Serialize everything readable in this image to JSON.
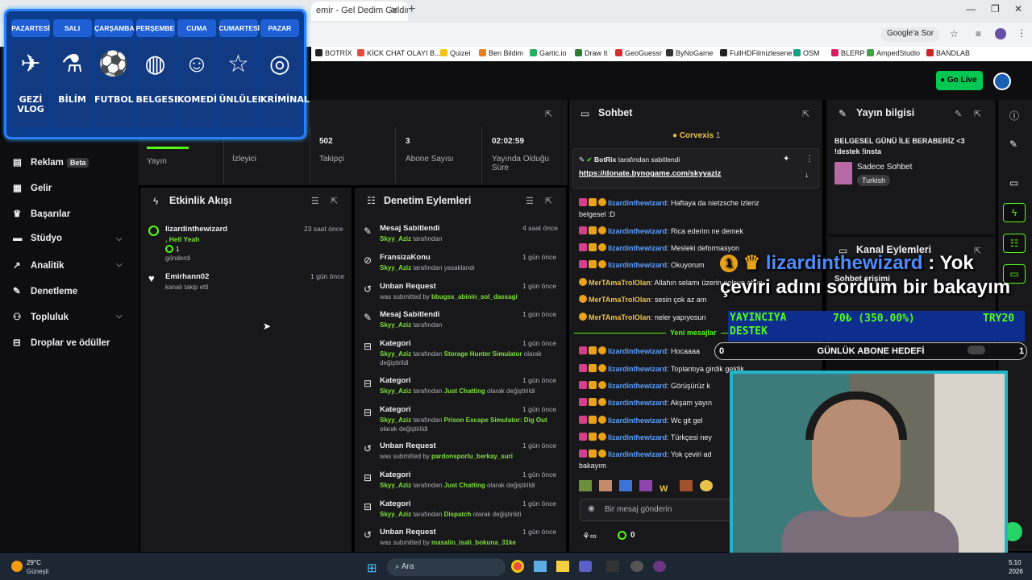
{
  "browser": {
    "tab_title": "emir - Gel Dedim Geldin",
    "google_sor": "Google'a Sor",
    "bookmarks": [
      "BOTRİX",
      "KİCK CHAT OLAYI B...",
      "Quizei",
      "Ben Bildim",
      "Gartic.io",
      "Draw It",
      "GeoGuessr",
      "ByNoGame",
      "FullHDFilmizlesene",
      "OSM",
      "BLERP",
      "AmpedStudio",
      "BANDLAB"
    ]
  },
  "header": {
    "go_live": "Go Live"
  },
  "schedule": {
    "days": [
      "PAZARTESİ",
      "SALI",
      "ÇARŞAMBA",
      "PERŞEMBE",
      "CUMA",
      "CUMARTESİ",
      "PAZAR"
    ],
    "categories": [
      {
        "label": "GEZİ VLOG",
        "icon": "globe-plane-icon"
      },
      {
        "label": "BİLİM",
        "icon": "science-icon"
      },
      {
        "label": "FUTBOL",
        "icon": "soccer-ball-icon"
      },
      {
        "label": "BELGESEL",
        "icon": "earth-icon"
      },
      {
        "label": "KOMEDİ",
        "icon": "comedy-masks-icon"
      },
      {
        "label": "ÜNLÜLER",
        "icon": "star-icon"
      },
      {
        "label": "KRİMİNAL",
        "icon": "fingerprint-icon"
      }
    ]
  },
  "nav": {
    "reklam": "Reklam",
    "beta": "Beta",
    "gelir": "Gelir",
    "basarilar": "Başarılar",
    "studyo": "Stüdyo",
    "analitik": "Analitik",
    "denetleme": "Denetleme",
    "topluluk": "Topluluk",
    "droplar": "Droplar ve ödüller"
  },
  "stats": {
    "yayin": "Yayın",
    "izleyici": "İzleyici",
    "takipci_value": "502",
    "takipci": "Takipçi",
    "abone_value": "3",
    "abone": "Abone Sayısı",
    "sure_value": "02:02:59",
    "sure": "Yayında Olduğu Süre"
  },
  "activity": {
    "title": "Etkinlik Akışı",
    "items": [
      {
        "name": "lizardinthewizard",
        "line1": ", Hell Yeah",
        "line2": "1",
        "line3": "gönderdi",
        "time": "23 saat önce"
      },
      {
        "name": "Emirhann02",
        "line1": "kanalı takip etti",
        "time": "1 gün önce"
      }
    ]
  },
  "moderation": {
    "title": "Denetim Eylemleri",
    "items": [
      {
        "title": "Mesaj Sabitlendi",
        "user": "Skyy_Aziz",
        "text": "tarafından",
        "time": "4 saat önce"
      },
      {
        "title": "FransizaKonu",
        "user": "Skyy_Aziz",
        "text": "tarafından yasaklandı",
        "time": "1 gün önce"
      },
      {
        "title": "Unban Request",
        "pre": "was submitted by",
        "user": "bbugss_abinin_sol_dassagi",
        "time": "1 gün önce"
      },
      {
        "title": "Mesaj Sabitlendi",
        "user": "Skyy_Aziz",
        "text": "tarafından",
        "time": "1 gün önce"
      },
      {
        "title": "Kategori",
        "user": "Skyy_Aziz",
        "text": "tarafından",
        "cat": "Storage Hunter Simulator",
        "post": "olarak değiştirildi",
        "time": "1 gün önce"
      },
      {
        "title": "Kategori",
        "user": "Skyy_Aziz",
        "text": "tarafından",
        "cat": "Just Chatting",
        "post": "olarak değiştirildi",
        "time": "1 gün önce"
      },
      {
        "title": "Kategori",
        "user": "Skyy_Aziz",
        "text": "tarafından",
        "cat": "Prison Escape Simulator: Dig Out",
        "post": "olarak değiştirildi",
        "time": "1 gün önce"
      },
      {
        "title": "Unban Request",
        "pre": "was submitted by",
        "user": "pardonsporlu_berkay_suri",
        "time": "1 gün önce"
      },
      {
        "title": "Kategori",
        "user": "Skyy_Aziz",
        "text": "tarafından",
        "cat": "Just Chatting",
        "post": "olarak değiştirildi",
        "time": "1 gün önce"
      },
      {
        "title": "Kategori",
        "user": "Skyy_Aziz",
        "text": "tarafından",
        "cat": "Dispatch",
        "post": "olarak değiştirildi",
        "time": "1 gün önce"
      },
      {
        "title": "Unban Request",
        "pre": "was submitted by",
        "user": "masalin_isali_bokuna_31ke",
        "time": "1 gün önce"
      }
    ]
  },
  "chat": {
    "title": "Sohbet",
    "top_user": "Corvexis",
    "top_count": "1",
    "pinned_by": "BotRix",
    "pinned_text": "tarafından sabitlendi",
    "pinned_link": "https://donate.bynogame.com/skyyaziz",
    "new_messages": "Yeni mesajlar",
    "placeholder": "Bir mesaj gönderin",
    "footer_count": "0",
    "messages": [
      {
        "user": "lizardinthewizard",
        "text": ": Haftaya da nietzsche izleriz"
      },
      {
        "user": "",
        "text": "belgesel :D"
      },
      {
        "user": "lizardinthewizard",
        "text": ": Rica ederim ne demek"
      },
      {
        "user": "lizardinthewizard",
        "text": ": Mesleki deformasyon"
      },
      {
        "user": "lizardinthewizard",
        "text": ": Okuyorum"
      },
      {
        "user": "MerTAmaTrolOlan",
        "text": ": Allahın selamı üzerin eolsun abim"
      },
      {
        "user": "MerTAmaTrolOlan",
        "text": ": sesin çok az am"
      },
      {
        "user": "MerTAmaTrolOlan",
        "text": ": neler yapıyosun"
      },
      {
        "user": "lizardinthewizard",
        "text": ": Hocaaaa"
      },
      {
        "user": "lizardinthewizard",
        "text": ": Toplantıya girdik geldik"
      },
      {
        "user": "lizardinthewizard",
        "text": ": Görüşürüz k"
      },
      {
        "user": "lizardinthewizard",
        "text": ": Akşam yayın"
      },
      {
        "user": "lizardinthewizard",
        "text": ": Wc git gel"
      },
      {
        "user": "lizardinthewizard",
        "text": ": Türkçesi ney"
      },
      {
        "user": "lizardinthewizard",
        "text": ": Yok çeviri ad"
      },
      {
        "user": "",
        "text": "bakayım"
      }
    ]
  },
  "stream_info": {
    "title": "Yayın bilgisi",
    "stream_title": "BELGESEL GÜNÜ İLE BERABERİZ <3 !destek !insta",
    "category": "Sadece Sohbet",
    "tag": "Turkish"
  },
  "channel_actions": {
    "title": "Kanal Eylemleri",
    "sub": "Sohbet erişimi"
  },
  "overlay": {
    "count": "1",
    "user": "lizardinthewizard",
    "text": ": Yok çeviri adını sordum bir bakayım",
    "destek_left": "YAYINCIYA DESTEK",
    "destek_mid": "70₺ (350.00%)",
    "destek_right": "TRY20",
    "goal_left": "0",
    "goal_label": "GÜNLÜK ABONE HEDEFİ",
    "goal_right": "1"
  },
  "taskbar": {
    "temp": "29°C",
    "weather": "Güneşli",
    "search": "Ara",
    "time": "5:10",
    "date": "2026"
  },
  "colors": {
    "accent": "#53fc18",
    "brand_blue": "#1f5fd6",
    "panel": "#18181b"
  }
}
